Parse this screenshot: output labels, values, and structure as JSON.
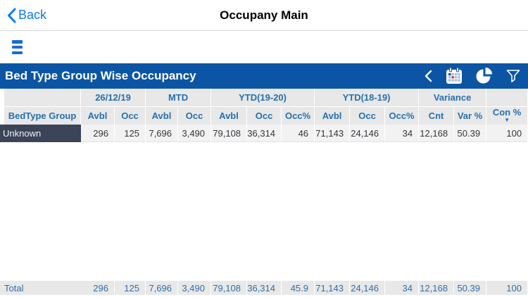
{
  "nav": {
    "back_label": "Back",
    "title": "Occupany Main"
  },
  "toolbar": {
    "title": "Bed Type Group Wise Occupancy",
    "icons": [
      "collapse-icon",
      "calendar-icon",
      "pie-chart-icon",
      "filter-icon"
    ]
  },
  "table": {
    "groups": [
      {
        "label": "",
        "span": 1
      },
      {
        "label": "26/12/19",
        "span": 2
      },
      {
        "label": "MTD",
        "span": 2
      },
      {
        "label": "YTD(19-20)",
        "span": 3
      },
      {
        "label": "YTD(18-19)",
        "span": 3
      },
      {
        "label": "Variance",
        "span": 2
      },
      {
        "label": "",
        "span": 1
      }
    ],
    "columns": [
      "BedType Group",
      "Avbl",
      "Occ",
      "Avbl",
      "Occ",
      "Avbl",
      "Occ",
      "Occ%",
      "Avbl",
      "Occ",
      "Occ%",
      "Cnt",
      "Var %",
      "Con %"
    ],
    "sort": {
      "column": "Con %",
      "direction": "desc",
      "caret": "▼"
    },
    "rows": [
      {
        "name": "Unknown",
        "values": [
          "296",
          "125",
          "7,696",
          "3,490",
          "79,108",
          "36,314",
          "46",
          "71,143",
          "24,146",
          "34",
          "12,168",
          "50.39",
          "100"
        ]
      }
    ],
    "total": {
      "label": "Total",
      "values": [
        "296",
        "125",
        "7,696",
        "3,490",
        "79,108",
        "36,314",
        "45.9",
        "71,143",
        "24,146",
        "34",
        "12,168",
        "50.39",
        "100"
      ]
    }
  },
  "colors": {
    "toolbar_blue": "#0b55a4",
    "ios_link_blue": "#0a7aff",
    "header_text_blue": "#2470ae",
    "row_header_dark": "#3b4459",
    "total_text_blue": "#306ea8",
    "header_bg_gray": "#e8e8e8"
  }
}
